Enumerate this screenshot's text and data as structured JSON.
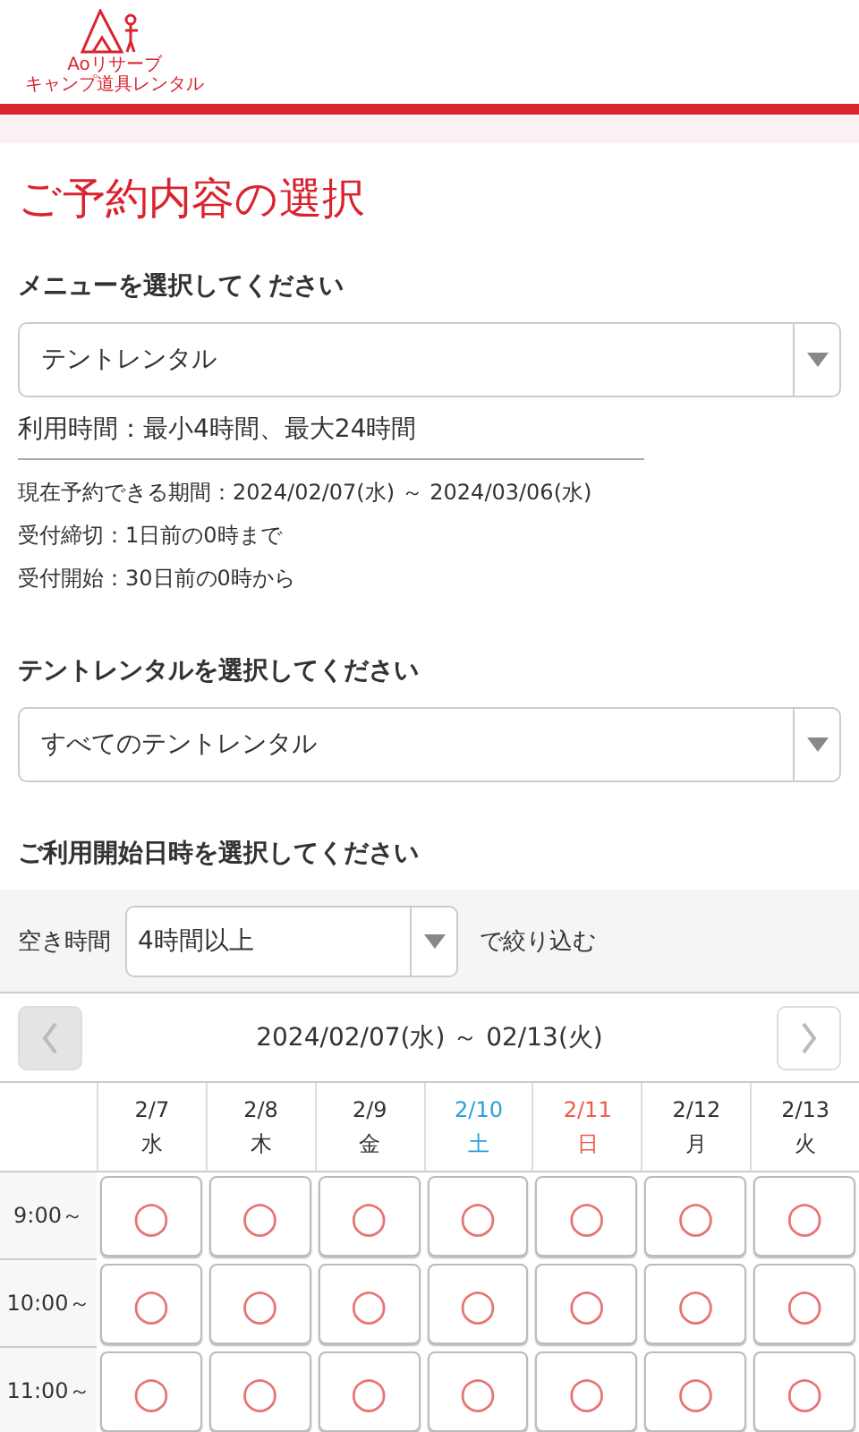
{
  "logo": {
    "line_1": "Aoリサーブ",
    "line_2": "キャンプ道具レンタル"
  },
  "page_title": "ご予約内容の選択",
  "menu": {
    "label": "メニューを選択してください",
    "value": "テントレンタル"
  },
  "usage_time": "利用時間：最小4時間、最大24時間",
  "notes": [
    "現在予約できる期間：2024/02/07(水) ～ 2024/03/06(水)",
    "受付締切：1日前の0時まで",
    "受付開始：30日前の0時から"
  ],
  "rental": {
    "label": "テントレンタルを選択してください",
    "value": "すべてのテントレンタル"
  },
  "datetime_label": "ご利用開始日時を選択してください",
  "filter": {
    "label": "空き時間",
    "value": "4時間以上",
    "suffix": "で絞り込む"
  },
  "week_nav": {
    "range": "2024/02/07(水) ～ 02/13(火)",
    "prev_disabled": true,
    "next_disabled": false
  },
  "days": [
    {
      "date": "2/7",
      "weekday": "水",
      "kind": "weekday"
    },
    {
      "date": "2/8",
      "weekday": "木",
      "kind": "weekday"
    },
    {
      "date": "2/9",
      "weekday": "金",
      "kind": "weekday"
    },
    {
      "date": "2/10",
      "weekday": "土",
      "kind": "saturday"
    },
    {
      "date": "2/11",
      "weekday": "日",
      "kind": "sunday"
    },
    {
      "date": "2/12",
      "weekday": "月",
      "kind": "weekday"
    },
    {
      "date": "2/13",
      "weekday": "火",
      "kind": "weekday"
    }
  ],
  "slots": [
    {
      "time": "9:00～",
      "marks": [
        "○",
        "○",
        "○",
        "○",
        "○",
        "○",
        "○"
      ]
    },
    {
      "time": "10:00～",
      "marks": [
        "○",
        "○",
        "○",
        "○",
        "○",
        "○",
        "○"
      ]
    },
    {
      "time": "11:00～",
      "marks": [
        "○",
        "○",
        "○",
        "○",
        "○",
        "○",
        "○"
      ]
    }
  ]
}
